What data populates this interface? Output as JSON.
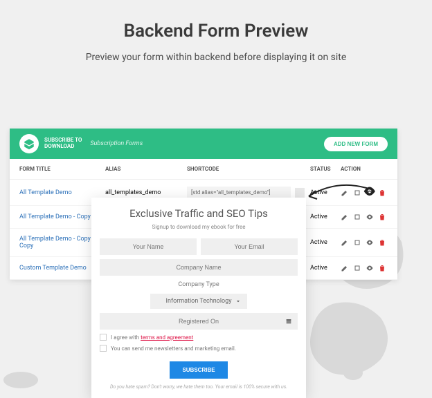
{
  "page": {
    "title": "Backend Form Preview",
    "subtitle": "Preview your form within backend before displaying it on site"
  },
  "header": {
    "logo_line1": "SUBSCRIBE TO",
    "logo_line2": "DOWNLOAD",
    "subtitle": "Subscription Forms",
    "add_button": "ADD NEW FORM"
  },
  "columns": {
    "title": "FORM TITLE",
    "alias": "ALIAS",
    "shortcode": "SHORTCODE",
    "status": "STATUS",
    "action": "ACTION"
  },
  "rows": [
    {
      "title": "All Template Demo",
      "alias": "all_templates_demo",
      "shortcode": "[std alias=\"all_templates_demo\"]",
      "status": "Active"
    },
    {
      "title": "All Template Demo - Copy",
      "alias": "",
      "shortcode": "",
      "status": "Active"
    },
    {
      "title": "All Template Demo - Copy - Copy",
      "alias": "",
      "shortcode": "",
      "status": "Active"
    },
    {
      "title": "Custom Template Demo",
      "alias": "",
      "shortcode": "",
      "status": "Active"
    }
  ],
  "form": {
    "title": "Exclusive Traffic and SEO Tips",
    "subtitle": "Signup to download my ebook for free",
    "name_ph": "Your Name",
    "email_ph": "Your Email",
    "company_ph": "Company Name",
    "type_label": "Company Type",
    "type_value": "Information Technology",
    "date_label": "Registered On",
    "agree_text": "I agree with ",
    "agree_link": "terms and agreement",
    "newsletter_text": "You can send me newsletters and marketing email.",
    "subscribe": "SUBSCRIBE",
    "footer": "Do you hate spam? Don't worry, we hate them too. Your email is 100% secure with us."
  }
}
